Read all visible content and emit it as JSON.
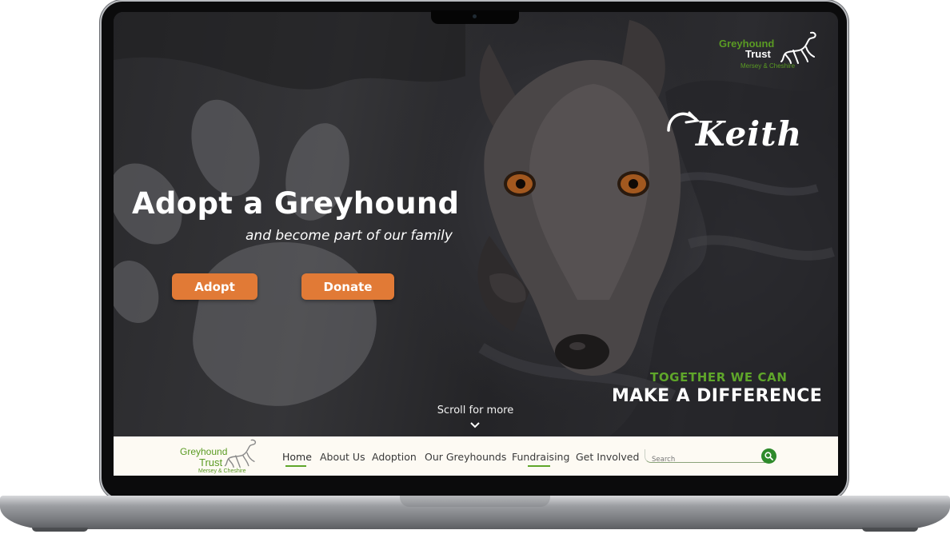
{
  "brand": {
    "name_line1": "Greyhound",
    "name_line2": "Trust",
    "region": "Mersey & Cheshire"
  },
  "hero": {
    "featured_dog_name": "Keith",
    "title": "Adopt a Greyhound",
    "subtitle": "and become part of our family",
    "adopt_label": "Adopt",
    "donate_label": "Donate",
    "scroll_label": "Scroll for more",
    "tagline_top": "TOGETHER WE CAN",
    "tagline_bottom": "MAKE A DIFFERENCE"
  },
  "nav": {
    "items": [
      {
        "label": "Home",
        "active": true
      },
      {
        "label": "About Us",
        "active": false
      },
      {
        "label": "Adoption",
        "active": false
      },
      {
        "label": "Our Greyhounds",
        "active": false
      },
      {
        "label": "Fundraising",
        "active": false
      },
      {
        "label": "Get Involved",
        "active": false
      }
    ]
  },
  "search": {
    "placeholder": "Search",
    "icon": "magnifier-icon"
  },
  "colors": {
    "accent_orange": "#e17a36",
    "brand_green": "#5fa62a",
    "nav_background": "#fdfaf3",
    "search_button": "#2e8a2b"
  }
}
